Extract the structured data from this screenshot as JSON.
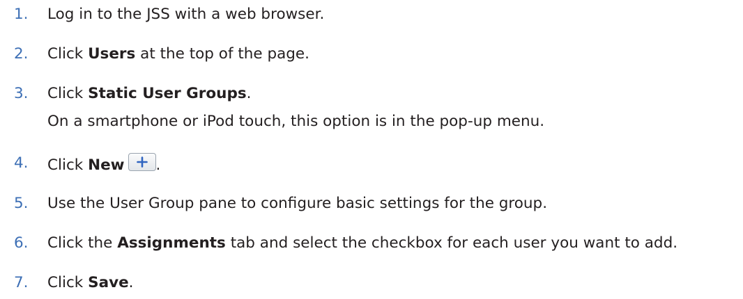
{
  "steps": [
    {
      "num": "1.",
      "text": "Log in to the JSS with a web browser."
    },
    {
      "num": "2.",
      "pre": "Click ",
      "bold": "Users",
      "post": " at the top of the page."
    },
    {
      "num": "3.",
      "pre": "Click ",
      "bold": "Static User Groups",
      "post": ".",
      "note": "On a smartphone or iPod touch, this option is in the pop-up menu."
    },
    {
      "num": "4.",
      "pre": "Click ",
      "bold": "New",
      "post": ".",
      "icon": "plus-icon"
    },
    {
      "num": "5.",
      "text": "Use the User Group pane to configure basic settings for the group."
    },
    {
      "num": "6.",
      "pre": "Click the ",
      "bold": "Assignments",
      "post": " tab and select the checkbox for each user you want to add."
    },
    {
      "num": "7.",
      "pre": "Click ",
      "bold": "Save",
      "post": "."
    }
  ],
  "colors": {
    "number": "#3d6fb5",
    "text": "#231f20",
    "plus_icon": "#2f64c0"
  }
}
